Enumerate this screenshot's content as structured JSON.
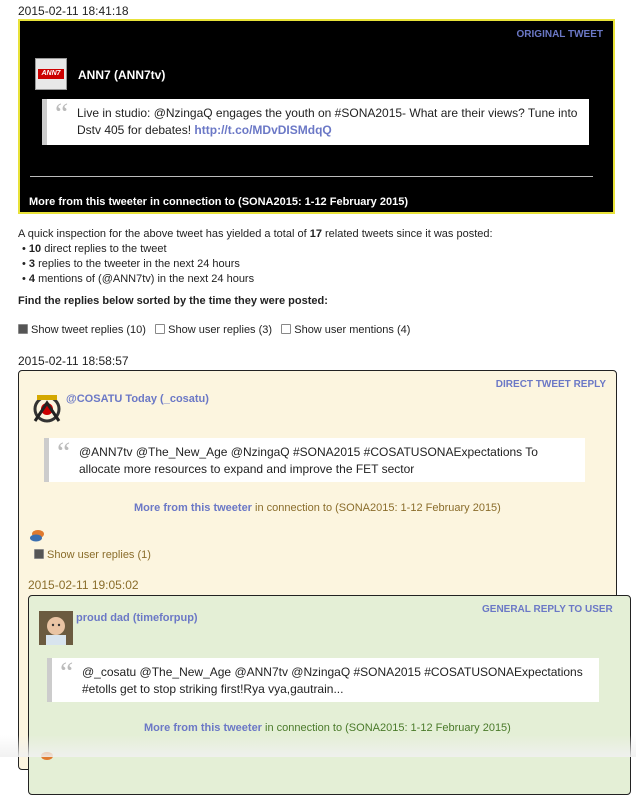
{
  "original": {
    "timestamp": "2015-02-11 18:41:18",
    "label": "ORIGINAL TWEET",
    "author": "ANN7 (ANN7tv)",
    "avatar_text": "ANN7",
    "text": "Live in studio: @NzingaQ engages the youth on #SONA2015- What are their views? Tune into Dstv 405 for debates!",
    "link": "http://t.co/MDvDISMdqQ",
    "more_link": "More from this tweeter",
    "more_suffix": "in connection to (SONA2015: 1-12 February 2015)"
  },
  "summary": {
    "intro_a": "A quick inspection for the above tweet has yielded a total of",
    "total": "17",
    "intro_b": "related tweets since it was posted:",
    "items": [
      {
        "count": "10",
        "text": "direct replies to the tweet"
      },
      {
        "count": "3",
        "text": "replies to the tweeter in the next 24 hours"
      },
      {
        "count": "4",
        "text": "mentions of (@ANN7tv) in the next 24 hours"
      }
    ],
    "sort_note": "Find the replies below sorted by the time they were posted:"
  },
  "filters": [
    {
      "label": "Show tweet replies (10)",
      "checked": true
    },
    {
      "label": "Show user replies (3)",
      "checked": false
    },
    {
      "label": "Show user mentions (4)",
      "checked": false
    }
  ],
  "reply1": {
    "timestamp": "2015-02-11 18:58:57",
    "label": "DIRECT TWEET REPLY",
    "author": "@COSATU Today (_cosatu)",
    "text": "@ANN7tv @The_New_Age @NzingaQ #SONA2015 #COSATUSONAExpectations To allocate more resources to expand and improve the FET sector",
    "more_link": "More from this tweeter",
    "more_suffix": "in connection to (SONA2015: 1-12 February 2015)",
    "show_replies": "Show user replies (1)"
  },
  "reply2": {
    "timestamp": "2015-02-11 19:05:02",
    "label": "GENERAL REPLY TO USER",
    "author": "proud dad (timeforpup)",
    "text": "@_cosatu @The_New_Age @ANN7tv @NzingaQ #SONA2015 #COSATUSONAExpectations #etolls get to stop striking first!Rya vya,gautrain...",
    "more_link": "More from this tweeter",
    "more_suffix": "in connection to (SONA2015: 1-12 February 2015)"
  },
  "colors": {
    "original_bg": "#000000",
    "original_border": "#e8e23a",
    "reply1_bg": "#fcf5df",
    "reply2_bg": "#e4efd6",
    "link": "#6b78c6"
  }
}
